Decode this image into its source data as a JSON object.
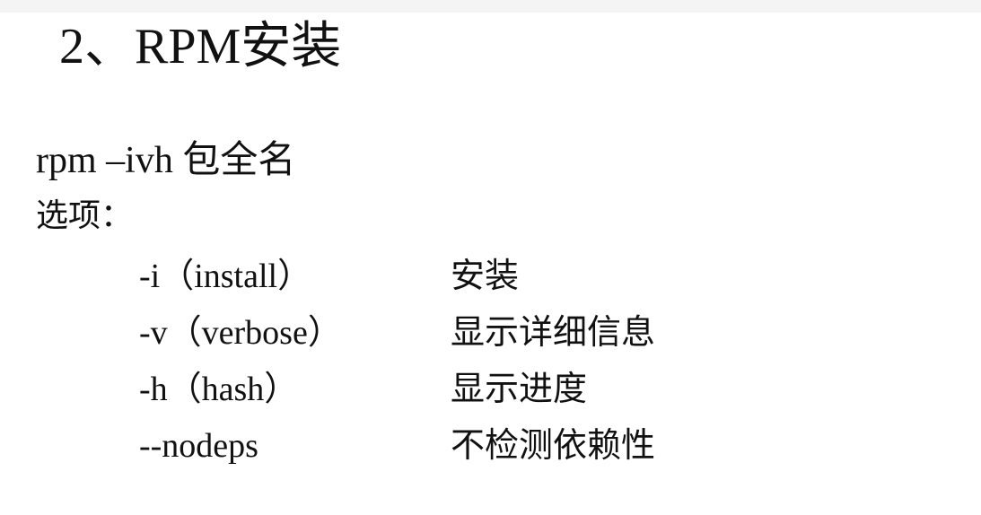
{
  "title": "2、RPM安装",
  "command": "rpm –ivh 包全名",
  "options_label": "选项：",
  "options": [
    {
      "flag": "-i（install）",
      "desc": "安装"
    },
    {
      "flag": "-v（verbose）",
      "desc": "显示详细信息"
    },
    {
      "flag": "-h（hash）",
      "desc": "显示进度"
    },
    {
      "flag": "--nodeps",
      "desc": "不检测依赖性"
    }
  ]
}
